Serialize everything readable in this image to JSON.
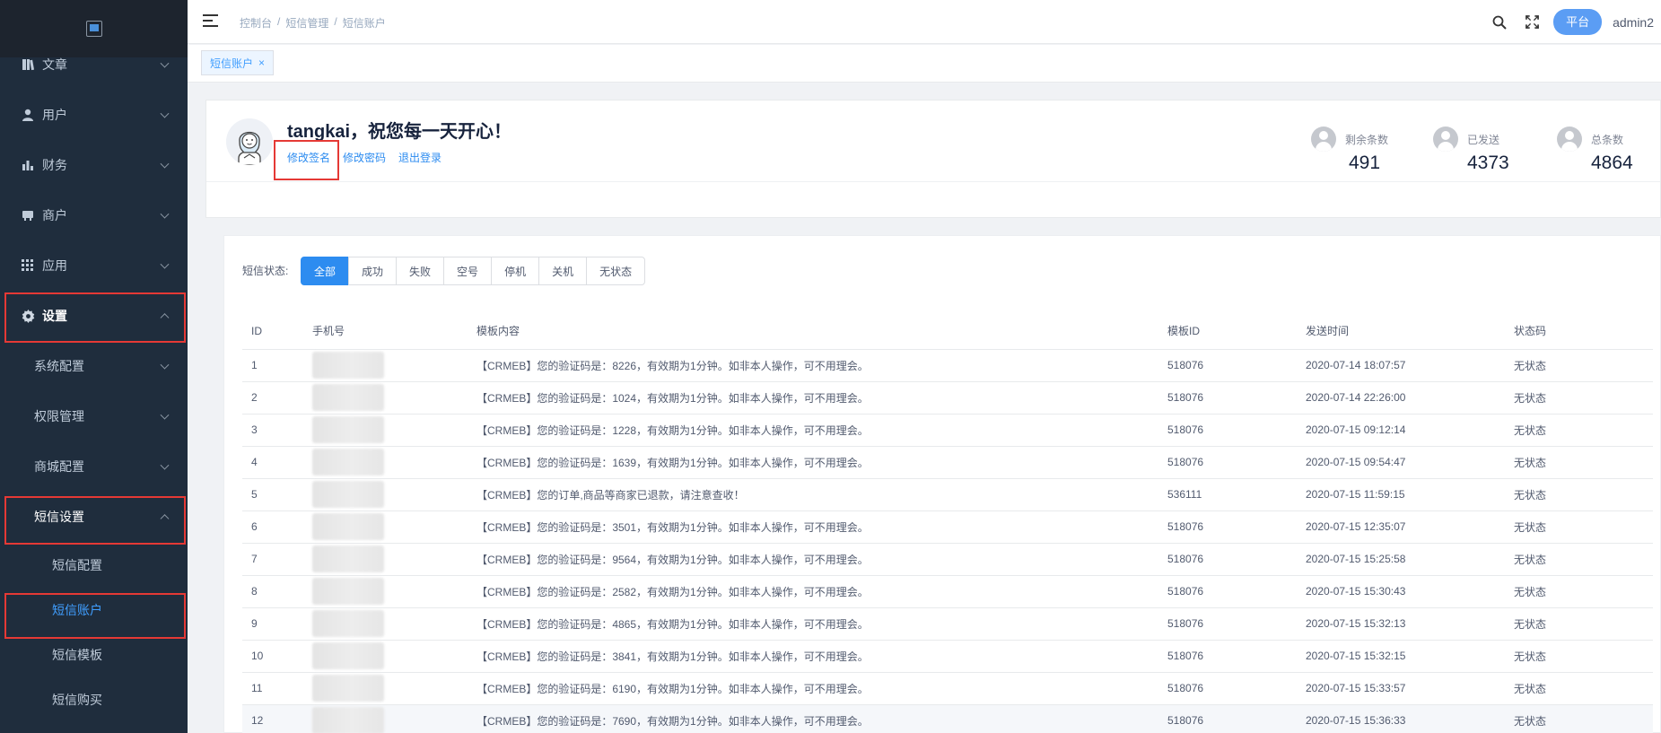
{
  "sidebar": {
    "logo_alt": "",
    "items": [
      {
        "label": "文章",
        "icon": "book-icon"
      },
      {
        "label": "用户",
        "icon": "user-icon"
      },
      {
        "label": "财务",
        "icon": "bar-chart-icon"
      },
      {
        "label": "商户",
        "icon": "store-icon"
      },
      {
        "label": "应用",
        "icon": "apps-icon"
      },
      {
        "label": "设置",
        "icon": "gear-icon"
      },
      {
        "label": "系统配置"
      },
      {
        "label": "权限管理"
      },
      {
        "label": "商城配置"
      },
      {
        "label": "短信设置"
      },
      {
        "label": "短信配置"
      },
      {
        "label": "短信账户"
      },
      {
        "label": "短信模板"
      },
      {
        "label": "短信购买"
      }
    ]
  },
  "header": {
    "breadcrumb": [
      "控制台",
      "短信管理",
      "短信账户"
    ],
    "platform_button": "平台",
    "username": "admin2"
  },
  "tags": {
    "active": "短信账户"
  },
  "account": {
    "greeting": "tangkai，祝您每一天开心！",
    "links": [
      "修改签名",
      "修改密码",
      "退出登录"
    ],
    "stats": [
      {
        "label": "剩余条数",
        "value": "491"
      },
      {
        "label": "已发送",
        "value": "4373"
      },
      {
        "label": "总条数",
        "value": "4864"
      }
    ]
  },
  "filter": {
    "label": "短信状态:",
    "options": [
      "全部",
      "成功",
      "失败",
      "空号",
      "停机",
      "关机",
      "无状态"
    ],
    "selected": "全部"
  },
  "table": {
    "columns": [
      "ID",
      "手机号",
      "模板内容",
      "模板ID",
      "发送时间",
      "状态码"
    ],
    "rows": [
      {
        "id": "1",
        "content": "【CRMEB】您的验证码是：8226，有效期为1分钟。如非本人操作，可不用理会。",
        "template_id": "518076",
        "time": "2020-07-14 18:07:57",
        "status": "无状态"
      },
      {
        "id": "2",
        "content": "【CRMEB】您的验证码是：1024，有效期为1分钟。如非本人操作，可不用理会。",
        "template_id": "518076",
        "time": "2020-07-14 22:26:00",
        "status": "无状态"
      },
      {
        "id": "3",
        "content": "【CRMEB】您的验证码是：1228，有效期为1分钟。如非本人操作，可不用理会。",
        "template_id": "518076",
        "time": "2020-07-15 09:12:14",
        "status": "无状态"
      },
      {
        "id": "4",
        "content": "【CRMEB】您的验证码是：1639，有效期为1分钟。如非本人操作，可不用理会。",
        "template_id": "518076",
        "time": "2020-07-15 09:54:47",
        "status": "无状态"
      },
      {
        "id": "5",
        "content": "【CRMEB】您的订单,商品等商家已退款，请注意查收！",
        "template_id": "536111",
        "time": "2020-07-15 11:59:15",
        "status": "无状态"
      },
      {
        "id": "6",
        "content": "【CRMEB】您的验证码是：3501，有效期为1分钟。如非本人操作，可不用理会。",
        "template_id": "518076",
        "time": "2020-07-15 12:35:07",
        "status": "无状态"
      },
      {
        "id": "7",
        "content": "【CRMEB】您的验证码是：9564，有效期为1分钟。如非本人操作，可不用理会。",
        "template_id": "518076",
        "time": "2020-07-15 15:25:58",
        "status": "无状态"
      },
      {
        "id": "8",
        "content": "【CRMEB】您的验证码是：2582，有效期为1分钟。如非本人操作，可不用理会。",
        "template_id": "518076",
        "time": "2020-07-15 15:30:43",
        "status": "无状态"
      },
      {
        "id": "9",
        "content": "【CRMEB】您的验证码是：4865，有效期为1分钟。如非本人操作，可不用理会。",
        "template_id": "518076",
        "time": "2020-07-15 15:32:13",
        "status": "无状态"
      },
      {
        "id": "10",
        "content": "【CRMEB】您的验证码是：3841，有效期为1分钟。如非本人操作，可不用理会。",
        "template_id": "518076",
        "time": "2020-07-15 15:32:15",
        "status": "无状态"
      },
      {
        "id": "11",
        "content": "【CRMEB】您的验证码是：6190，有效期为1分钟。如非本人操作，可不用理会。",
        "template_id": "518076",
        "time": "2020-07-15 15:33:57",
        "status": "无状态"
      },
      {
        "id": "12",
        "content": "【CRMEB】您的验证码是：7690，有效期为1分钟。如非本人操作，可不用理会。",
        "template_id": "518076",
        "time": "2020-07-15 15:36:33",
        "status": "无状态"
      }
    ]
  },
  "colors": {
    "sidebar_bg": "#1f2d3d",
    "accent": "#2d8cf0",
    "highlight_box": "#e53935"
  }
}
